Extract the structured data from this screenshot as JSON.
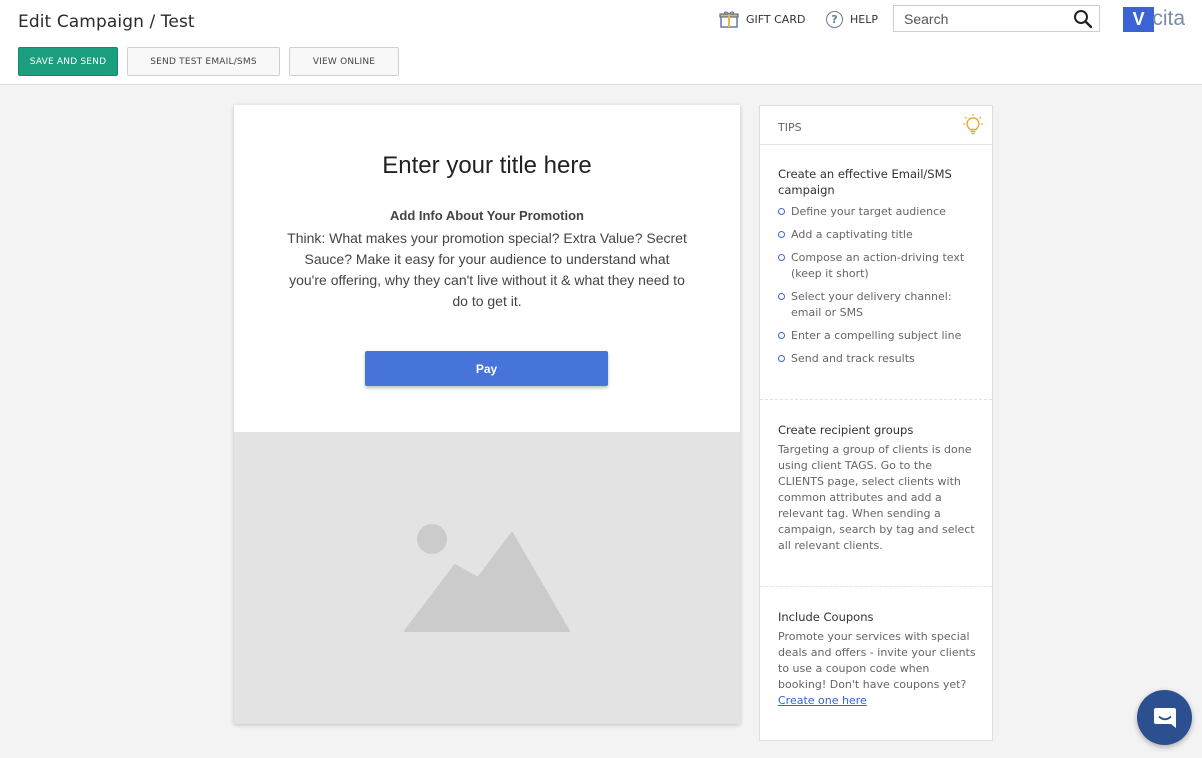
{
  "header": {
    "title": "Edit Campaign / Test",
    "gift_card_label": "GIFT CARD",
    "help_label": "HELP",
    "search_placeholder": "Search",
    "logo_text": "cita"
  },
  "toolbar": {
    "save_and_send": "SAVE AND SEND",
    "send_test": "SEND TEST EMAIL/SMS",
    "view_online": "VIEW ONLINE"
  },
  "editor": {
    "title": "Enter your title here",
    "subheading": "Add Info About Your Promotion",
    "body": "Think: What makes your promotion special? Extra Value? Secret Sauce? Make it easy for your audience to understand what you're offering, why they can't live without it & what they need to do to get it.",
    "button_label": "Pay"
  },
  "tips": {
    "header": "TIPS",
    "section1": {
      "title": "Create an effective Email/SMS campaign",
      "items": [
        "Define your target audience",
        "Add a captivating title",
        "Compose an action-driving text (keep it short)",
        "Select your delivery channel: email or SMS",
        "Enter a compelling subject line",
        "Send and track results"
      ]
    },
    "section2": {
      "title": "Create recipient groups",
      "text": "Targeting a group of clients is done using client TAGS. Go to the CLIENTS page, select clients with common attributes and add a relevant tag. When sending a campaign, search by tag and select all relevant clients."
    },
    "section3": {
      "title": "Include Coupons",
      "text": "Promote your services with special deals and offers - invite your clients to use a coupon code when booking! Don't have coupons yet?",
      "link": "Create one here"
    }
  },
  "colors": {
    "primary_green": "#1a9e7d",
    "pay_blue": "#4674d8",
    "chat_blue": "#2c4f8f",
    "bullet_blue": "#3d65d4"
  }
}
